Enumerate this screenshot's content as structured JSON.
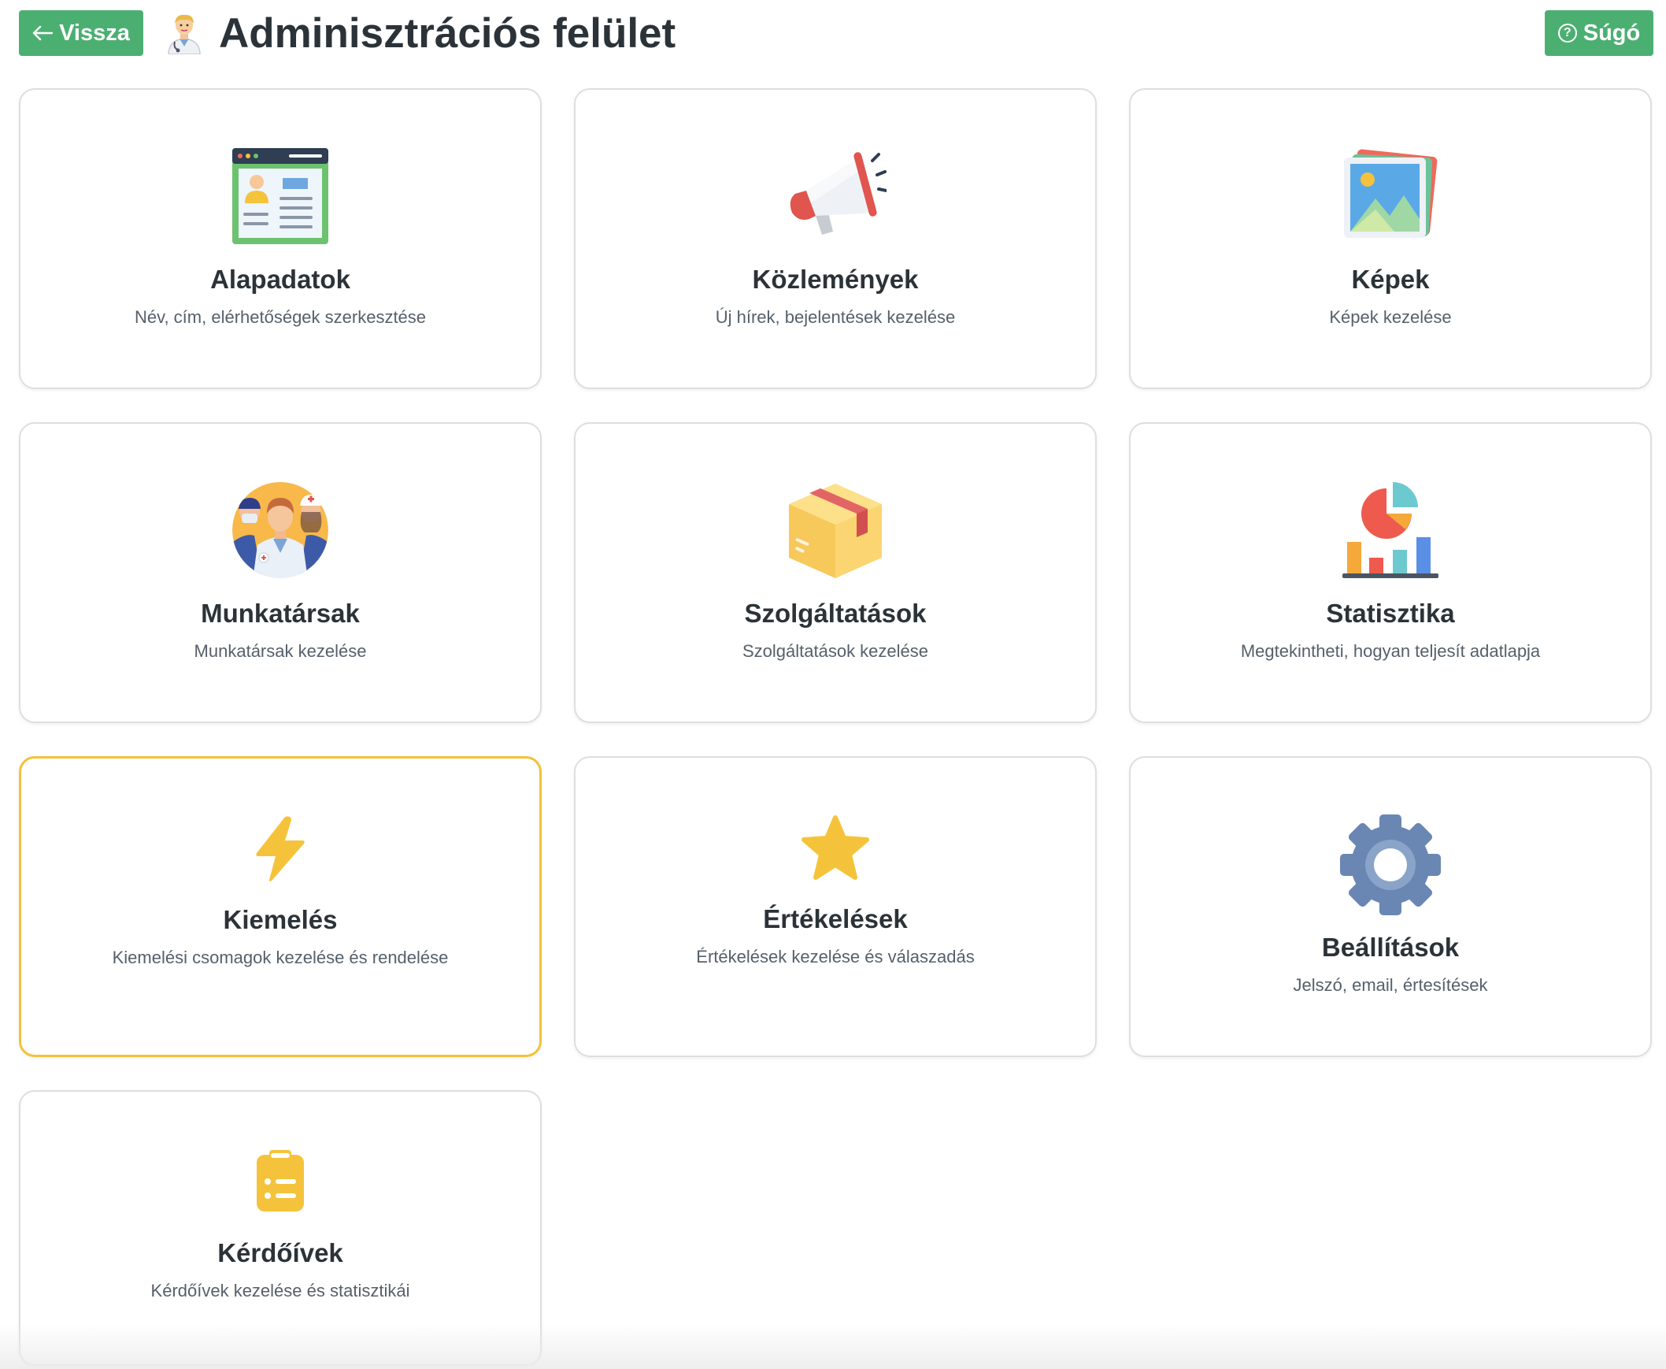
{
  "header": {
    "back_label": "Vissza",
    "title": "Adminisztrációs felület",
    "help_label": "Súgó"
  },
  "cards": [
    {
      "title": "Alapadatok",
      "description": "Név, cím, elérhetőségek szerkesztése",
      "icon": "profile-window-icon"
    },
    {
      "title": "Közlemények",
      "description": "Új hírek, bejelentések kezelése",
      "icon": "megaphone-icon"
    },
    {
      "title": "Képek",
      "description": "Képek kezelése",
      "icon": "pictures-icon"
    },
    {
      "title": "Munkatársak",
      "description": "Munkatársak kezelése",
      "icon": "medical-team-icon"
    },
    {
      "title": "Szolgáltatások",
      "description": "Szolgáltatások kezelése",
      "icon": "package-box-icon"
    },
    {
      "title": "Statisztika",
      "description": "Megtekintheti, hogyan teljesít adatlapja",
      "icon": "statistics-chart-icon"
    },
    {
      "title": "Kiemelés",
      "description": "Kiemelési csomagok kezelése és rendelése",
      "icon": "lightning-bolt-icon",
      "active": true
    },
    {
      "title": "Értékelések",
      "description": "Értékelések kezelése és válaszadás",
      "icon": "star-icon"
    },
    {
      "title": "Beállítások",
      "description": "Jelszó, email, értesítések",
      "icon": "gear-icon"
    },
    {
      "title": "Kérdőívek",
      "description": "Kérdőívek kezelése és statisztikái",
      "icon": "clipboard-list-icon"
    }
  ],
  "colors": {
    "accent_green": "#4caf72",
    "active_border": "#f2c23b",
    "icon_yellow": "#f5c33b",
    "gear_blue": "#6a86b3"
  }
}
